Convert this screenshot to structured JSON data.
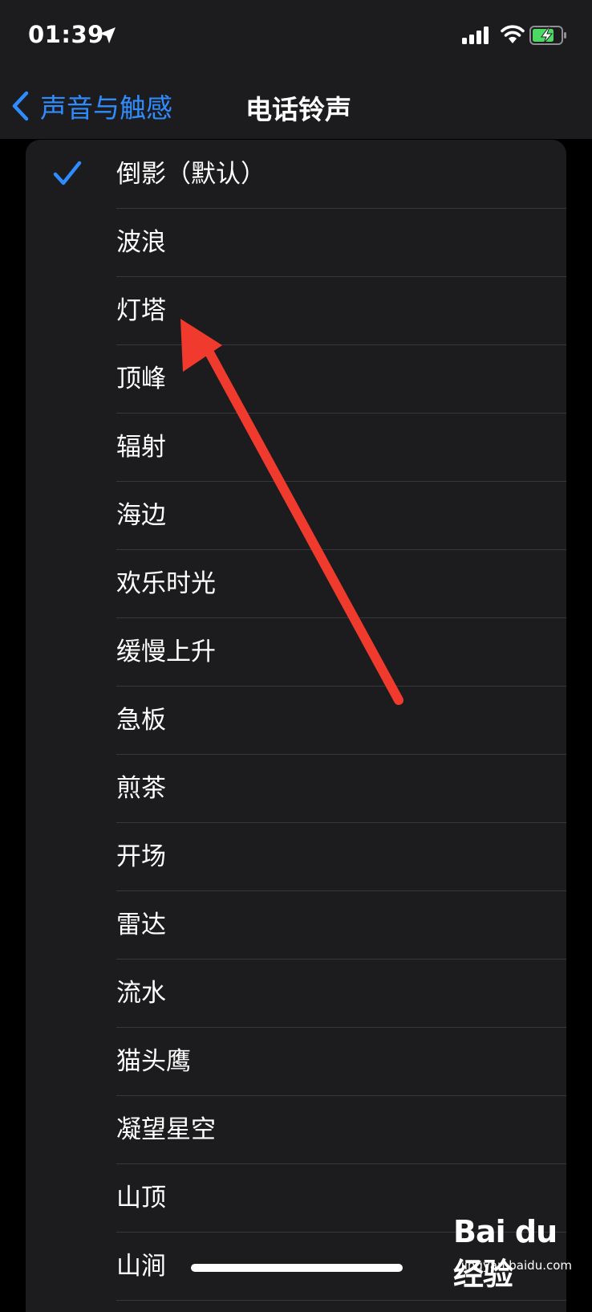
{
  "status_bar": {
    "time": "01:39",
    "icons": [
      "location-arrow-icon",
      "cellular-signal-icon",
      "wifi-icon",
      "battery-charging-icon"
    ]
  },
  "nav": {
    "back_label": "声音与触感",
    "title": "电话铃声"
  },
  "colors": {
    "accent": "#2f8cff",
    "background": "#000000",
    "card": "#1c1c1e",
    "separator": "#38383a",
    "annotation_arrow": "#f03a2e",
    "battery": "#4cd964"
  },
  "ringtones": [
    {
      "label": "倒影（默认）",
      "selected": true
    },
    {
      "label": "波浪",
      "selected": false
    },
    {
      "label": "灯塔",
      "selected": false
    },
    {
      "label": "顶峰",
      "selected": false
    },
    {
      "label": "辐射",
      "selected": false
    },
    {
      "label": "海边",
      "selected": false
    },
    {
      "label": "欢乐时光",
      "selected": false
    },
    {
      "label": "缓慢上升",
      "selected": false
    },
    {
      "label": "急板",
      "selected": false
    },
    {
      "label": "煎茶",
      "selected": false
    },
    {
      "label": "开场",
      "selected": false
    },
    {
      "label": "雷达",
      "selected": false
    },
    {
      "label": "流水",
      "selected": false
    },
    {
      "label": "猫头鹰",
      "selected": false
    },
    {
      "label": "凝望星空",
      "selected": false
    },
    {
      "label": "山顶",
      "selected": false
    },
    {
      "label": "山涧",
      "selected": false
    }
  ],
  "watermark": {
    "logo": "Bai du 经验",
    "url": "jingyan.baidu.com"
  }
}
